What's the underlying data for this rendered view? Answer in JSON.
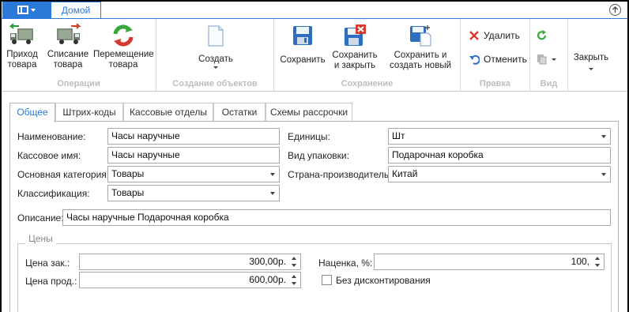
{
  "ribbon_tabs": {
    "home": "Домой"
  },
  "groups": {
    "operations": {
      "label": "Операции",
      "receive": "Приход товара",
      "writeoff": "Списание товара",
      "move": "Перемещение товара"
    },
    "create": {
      "label": "Создание объектов",
      "create_btn": "Создать"
    },
    "save": {
      "label": "Сохранение",
      "save_btn": "Сохранить",
      "save_close_btn": "Сохранить и закрыть",
      "save_new_btn": "Сохранить и создать новый"
    },
    "edit": {
      "label": "Правка",
      "delete_btn": "Удалить",
      "undo_btn": "Отменить"
    },
    "view": {
      "label": "Вид",
      "close_btn": "Закрыть"
    }
  },
  "doc_tabs": [
    "Общее",
    "Штрих-коды",
    "Кассовые отделы",
    "Остатки",
    "Схемы рассрочки"
  ],
  "form": {
    "name_label": "Наименование:",
    "name_value": "Часы наручные",
    "cash_name_label": "Кассовое имя:",
    "cash_name_value": "Часы наручные",
    "category_label": "Основная категория:",
    "category_value": "Товары",
    "class_label": "Классификация:",
    "class_value": "Товары",
    "units_label": "Единицы:",
    "units_value": "Шт",
    "pack_label": "Вид упаковки:",
    "pack_value": "Подарочная коробка",
    "country_label": "Страна-производитель:",
    "country_value": "Китай",
    "desc_label": "Описание:",
    "desc_value": "Часы наручные Подарочная коробка"
  },
  "prices": {
    "legend": "Цены",
    "cost_label": "Цена зак.:",
    "cost_value": "300,00р.",
    "sale_label": "Цена прод.:",
    "sale_value": "600,00р.",
    "markup_label": "Наценка, %:",
    "markup_value": "100,",
    "no_discount_label": "Без дисконтирования",
    "no_discount_checked": false
  },
  "colors": {
    "accent": "#2b79d8",
    "group_label": "#bdbdbd"
  }
}
